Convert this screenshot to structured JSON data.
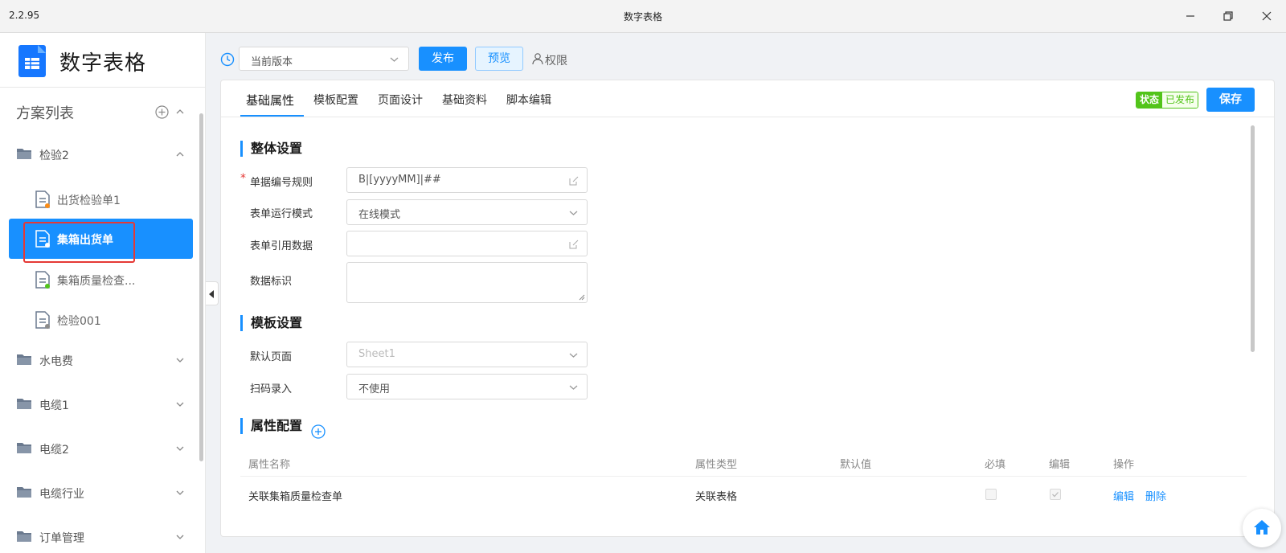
{
  "window": {
    "version": "2.2.95",
    "title": "数字表格"
  },
  "sidebar": {
    "app_name": "数字表格",
    "list_title": "方案列表",
    "groups": [
      {
        "label": "检验2",
        "expanded": true,
        "docs": [
          {
            "label": "出货检验单1",
            "dot_color": "#fa8c16"
          },
          {
            "label": "集箱出货单",
            "active": true,
            "dot_color": "#ffffff"
          },
          {
            "label": "集箱质量检查...",
            "dot_color": "#52c41a"
          },
          {
            "label": "检验001",
            "dot_color": "#8c8c8c"
          }
        ]
      },
      {
        "label": "水电费",
        "expanded": false
      },
      {
        "label": "电缆1",
        "expanded": false
      },
      {
        "label": "电缆2",
        "expanded": false
      },
      {
        "label": "电缆行业",
        "expanded": false
      },
      {
        "label": "订单管理",
        "expanded": false
      }
    ]
  },
  "toolbar": {
    "version_select": "当前版本",
    "publish_label": "发布",
    "preview_label": "预览",
    "permission_label": "权限"
  },
  "tabs": [
    "基础属性",
    "模板配置",
    "页面设计",
    "基础资料",
    "脚本编辑"
  ],
  "status": {
    "key": "状态",
    "value": "已发布"
  },
  "save_label": "保存",
  "sections": {
    "overall": "整体设置",
    "template": "模板设置",
    "attributes": "属性配置"
  },
  "form": {
    "bill_no_rule": {
      "label": "单据编号规则",
      "value": "B|[yyyyMM]|##"
    },
    "run_mode": {
      "label": "表单运行模式",
      "value": "在线模式"
    },
    "ref_data": {
      "label": "表单引用数据",
      "value": ""
    },
    "data_id": {
      "label": "数据标识",
      "value": ""
    },
    "default_page": {
      "label": "默认页面",
      "value": "Sheet1"
    },
    "scan_input": {
      "label": "扫码录入",
      "value": "不使用"
    }
  },
  "table": {
    "headers": [
      "属性名称",
      "属性类型",
      "默认值",
      "必填",
      "编辑",
      "操作"
    ],
    "rows": [
      {
        "name": "关联集箱质量检查单",
        "type": "关联表格",
        "default": "",
        "required": false,
        "editable": true,
        "actions": [
          "编辑",
          "删除"
        ]
      }
    ]
  },
  "colors": {
    "accent": "#1890ff",
    "success": "#52c41a",
    "highlight": "#e53935"
  }
}
